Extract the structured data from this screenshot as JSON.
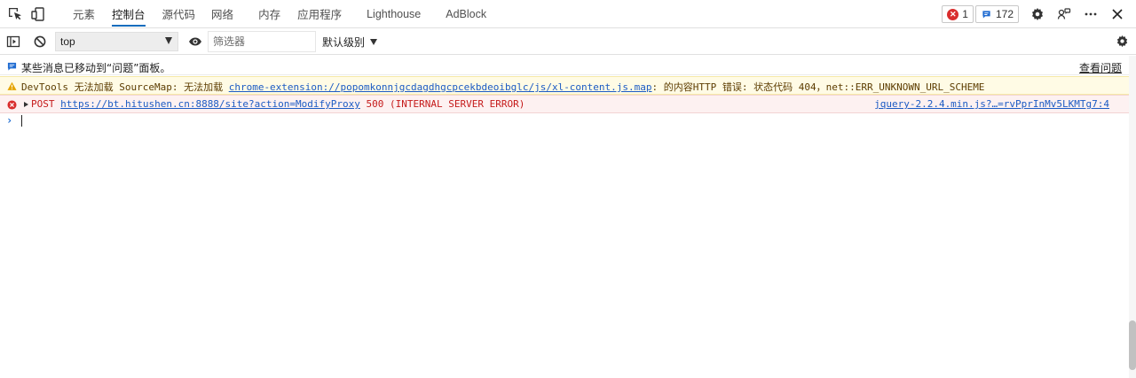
{
  "tabs": [
    {
      "label": "元素"
    },
    {
      "label": "控制台"
    },
    {
      "label": "源代码"
    },
    {
      "label": "网络"
    },
    {
      "label": "内存"
    },
    {
      "label": "应用程序"
    },
    {
      "label": "Lighthouse"
    },
    {
      "label": "AdBlock"
    }
  ],
  "active_tab": "控制台",
  "badges": {
    "errors": "1",
    "messages": "172"
  },
  "toolbar": {
    "context": "top",
    "filter_placeholder": "筛选器",
    "levels": "默认级别"
  },
  "console": {
    "info_text": "某些消息已移动到“问题”面板。",
    "info_link": "查看问题",
    "warning": {
      "prefix": "DevTools 无法加载 SourceMap: 无法加载 ",
      "url": "chrome-extension://popomkonnjgcdagdhgcpcekbdeoibglc/js/xl-content.js.map",
      "suffix": ": 的内容HTTP 错误: 状态代码 404，net::ERR_UNKNOWN_URL_SCHEME"
    },
    "error": {
      "method": "POST ",
      "url": "https://bt.hitushen.cn:8888/site?action=ModifyProxy",
      "status": " 500 (INTERNAL SERVER ERROR)",
      "source": "jquery-2.2.4.min.js?…=rvPprInMv5LKMTg7:4"
    },
    "prompt": "›"
  },
  "colors": {
    "accent": "#0f6cbd",
    "error": "#d92d2d",
    "warning_bg": "#fffbe5",
    "error_bg": "#fdf1f1"
  },
  "icons": [
    "inspect-icon",
    "device-toggle-icon",
    "error-icon",
    "message-icon",
    "settings-icon",
    "share-icon",
    "more-icon",
    "close-icon",
    "sidebar-toggle-icon",
    "clear-icon",
    "eye-icon",
    "info-icon",
    "warning-icon"
  ]
}
